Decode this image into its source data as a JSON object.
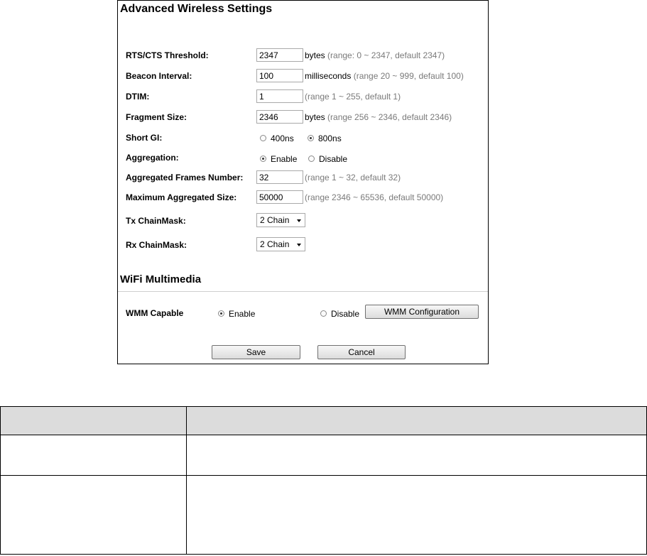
{
  "panel": {
    "title": "Advanced Wireless Settings",
    "rts": {
      "label": "RTS/CTS Threshold:",
      "value": "2347",
      "unit": "bytes",
      "hint": "(range: 0 ~ 2347, default 2347)"
    },
    "beacon": {
      "label": "Beacon Interval:",
      "value": "100",
      "unit": "milliseconds",
      "hint": "(range 20 ~ 999, default 100)"
    },
    "dtim": {
      "label": "DTIM:",
      "value": "1",
      "hint": "(range 1 ~ 255, default 1)"
    },
    "fragment": {
      "label": "Fragment Size:",
      "value": "2346",
      "unit": "bytes",
      "hint": "(range 256 ~ 2346, default 2346)"
    },
    "short_gi": {
      "label": "Short GI:",
      "option1": "400ns",
      "option2": "800ns",
      "selected": "800ns"
    },
    "aggregation": {
      "label": "Aggregation:",
      "option1": "Enable",
      "option2": "Disable",
      "selected": "Enable"
    },
    "agg_frames": {
      "label": "Aggregated Frames Number:",
      "value": "32",
      "hint": "(range 1 ~ 32, default 32)"
    },
    "agg_size": {
      "label": "Maximum Aggregated Size:",
      "value": "50000",
      "hint": "(range 2346 ~ 65536, default 50000)"
    },
    "tx_chainmask": {
      "label": "Tx ChainMask:",
      "value": "2 Chain"
    },
    "rx_chainmask": {
      "label": "Rx ChainMask:",
      "value": "2 Chain"
    }
  },
  "wmm": {
    "title": "WiFi Multimedia",
    "label": "WMM Capable",
    "option1": "Enable",
    "option2": "Disable",
    "selected": "Enable",
    "config_button": "WMM Configuration"
  },
  "actions": {
    "save": "Save",
    "cancel": "Cancel"
  },
  "table": {
    "header": [
      "",
      ""
    ],
    "rows": [
      [
        "",
        ""
      ],
      [
        "",
        ""
      ]
    ]
  }
}
